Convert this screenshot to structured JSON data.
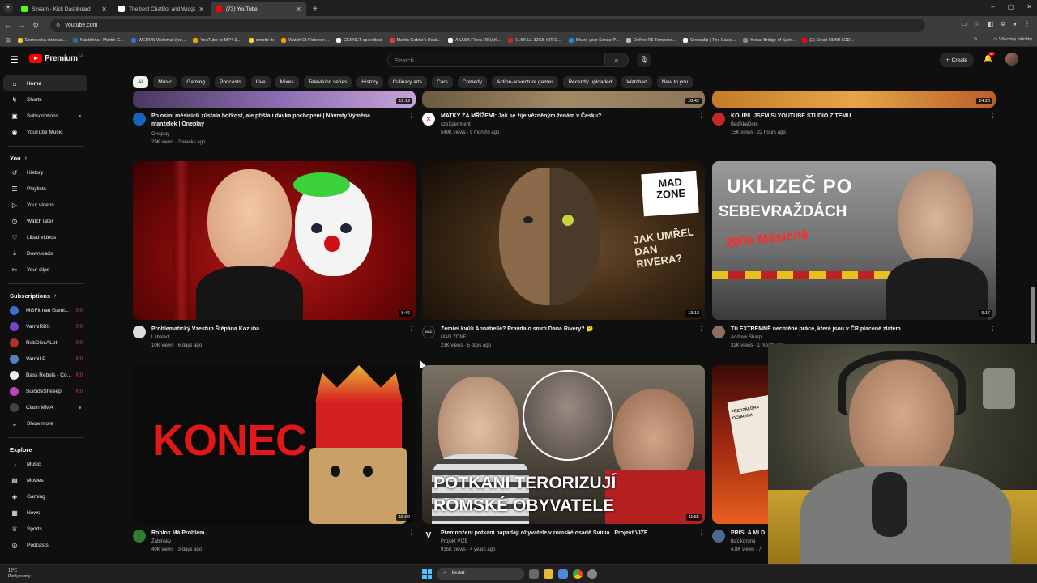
{
  "browser": {
    "tabs": [
      {
        "title": "Stream - Kick Dashboard",
        "color": "#53fc18",
        "active": false
      },
      {
        "title": "The best ChatBot and Widgets",
        "color": "#ffffff",
        "active": false
      },
      {
        "title": "(73) YouTube",
        "color": "#ff0000",
        "active": true
      }
    ],
    "url": "youtube.com",
    "bookmarks": [
      {
        "label": "Domovská stránka...",
        "color": "#f4c430"
      },
      {
        "label": "Nástěnka ‹ Martin G...",
        "color": "#21759b"
      },
      {
        "label": "WEDOS Webmail (we...",
        "color": "#2f6fd6"
      },
      {
        "label": "YouTube to MP4 &...",
        "color": "#e5a800"
      },
      {
        "label": "emotic fb",
        "color": "#f7d43b"
      },
      {
        "label": "Watch Ct Fletcher:...",
        "color": "#ff9800"
      },
      {
        "label": "CESNET speedtest",
        "color": "#ffffff"
      },
      {
        "label": "Martin Gabko's Real...",
        "color": "#e53935"
      },
      {
        "label": "AKASA Flexa V8 (AK...",
        "color": "#ffffff"
      },
      {
        "label": "G.SKILL 32GB KIT D...",
        "color": "#c62828"
      },
      {
        "label": "Share your SensorP...",
        "color": "#1e88e5"
      },
      {
        "label": "Define R6 Tempere...",
        "color": "#bbbbbb"
      },
      {
        "label": "Crossclip | The Easie...",
        "color": "#ffffff"
      },
      {
        "label": "Kena: Bridge of Spiri...",
        "color": "#888888"
      },
      {
        "label": "(2) Sinch HDMI LCD...",
        "color": "#ff0000"
      }
    ],
    "bookmarks_right": "Všechny záložky"
  },
  "header": {
    "logo_text": "Premium",
    "logo_country": "CZ",
    "search_placeholder": "Search",
    "create_label": "Create",
    "notif_count": "9+"
  },
  "sidebar": {
    "main": [
      {
        "label": "Home",
        "icon": "home-icon",
        "glyph": "⌂",
        "active": true
      },
      {
        "label": "Shorts",
        "icon": "shorts-icon",
        "glyph": "↯"
      },
      {
        "label": "Subscriptions",
        "icon": "subscriptions-icon",
        "glyph": "▣",
        "dot": true
      },
      {
        "label": "YouTube Music",
        "icon": "music-icon",
        "glyph": "◉"
      }
    ],
    "you_title": "You",
    "you": [
      {
        "label": "History",
        "icon": "history-icon",
        "glyph": "↺"
      },
      {
        "label": "Playlists",
        "icon": "playlists-icon",
        "glyph": "☰"
      },
      {
        "label": "Your videos",
        "icon": "your-videos-icon",
        "glyph": "▷"
      },
      {
        "label": "Watch later",
        "icon": "watch-later-icon",
        "glyph": "◷"
      },
      {
        "label": "Liked videos",
        "icon": "liked-icon",
        "glyph": "♡"
      },
      {
        "label": "Downloads",
        "icon": "downloads-icon",
        "glyph": "⤓"
      },
      {
        "label": "Your clips",
        "icon": "clips-icon",
        "glyph": "✂"
      }
    ],
    "subs_title": "Subscriptions",
    "subs": [
      {
        "label": "MGFitman Gami...",
        "color": "#3c6fd1",
        "live": "((•))"
      },
      {
        "label": "VarmiRBX",
        "color": "#7b3fd1",
        "live": "((•))"
      },
      {
        "label": "RobDiesALot",
        "color": "#b03030",
        "live": "((•))"
      },
      {
        "label": "VarmiLP",
        "color": "#5080c0",
        "live": "((•))"
      },
      {
        "label": "Bass Rebels - Co...",
        "color": "#eeeeee",
        "live": "((•))"
      },
      {
        "label": "SuicideSheeep",
        "color": "#c040c0",
        "live": "((•))"
      },
      {
        "label": "Clash MMA",
        "color": "#444444",
        "dot": true
      }
    ],
    "show_more": "Show more",
    "explore_title": "Explore",
    "explore": [
      {
        "label": "Music",
        "icon": "music-note-icon",
        "glyph": "♪"
      },
      {
        "label": "Movies",
        "icon": "movies-icon",
        "glyph": "▤"
      },
      {
        "label": "Gaming",
        "icon": "gaming-icon",
        "glyph": "◈"
      },
      {
        "label": "News",
        "icon": "news-icon",
        "glyph": "▦"
      },
      {
        "label": "Sports",
        "icon": "sports-icon",
        "glyph": "♕"
      },
      {
        "label": "Podcasts",
        "icon": "podcasts-icon",
        "glyph": "◎"
      }
    ]
  },
  "chips": [
    "All",
    "Music",
    "Gaming",
    "Podcasts",
    "Live",
    "Mixes",
    "Television series",
    "History",
    "Culinary arts",
    "Cars",
    "Comedy",
    "Action-adventure games",
    "Recently uploaded",
    "Watched",
    "New to you"
  ],
  "videos_top": [
    {
      "title": "Po osmi měsících zůstala hořkost, ale přišla i dávka pochopení | Návraty Výměna manželek | Oneplay",
      "channel": "Oneplay",
      "stats": "29K views · 2 weeks ago",
      "duration": "12:19",
      "avatar": "#1565c0"
    },
    {
      "title": "MATKY ZA MŘÍŽEMI: Jak se žije vězněným ženám v Česku?",
      "channel": "czeXperiment",
      "stats": "549K views · 9 months ago",
      "duration": "18:42",
      "avatar": "#e91e63"
    },
    {
      "title": "KOUPIL JSEM SI YOUTUBE STUDIO Z TEMU",
      "channel": "BedAkaDom",
      "stats": "15K views · 22 hours ago",
      "duration": "14:20",
      "avatar": "#c62828"
    }
  ],
  "videos_mid": [
    {
      "title": "Problematický Vzestup Štěpána Kozuba",
      "channel": "Labeled",
      "stats": "10K views · 6 days ago",
      "duration": "8:46",
      "avatar": "#cccccc"
    },
    {
      "title": "Zemřel kvůli Annabelle? Pravda o smrti Dana Rivery? 🤔",
      "channel": "MAD ZONE",
      "stats": "23K views · 5 days ago",
      "duration": "13:12",
      "avatar": "#111111"
    },
    {
      "title": "Tři EXTRÉMNĚ nechtěné práce, které jsou v ČR placené zlatem",
      "channel": "Andrew Sharp",
      "stats": "32K views · 1 month ago",
      "duration": "9:17",
      "avatar": "#8d6e63"
    }
  ],
  "videos_bottom": [
    {
      "title": "Roblox Má Problém...",
      "channel": "Žabinsky",
      "stats": "40K views · 3 days ago",
      "duration": "15:09",
      "avatar": "#2e7d32"
    },
    {
      "title": "Přemnožení potkani napadají obyvatele v romské osadě Svinia | Projekt VIZE",
      "channel": "Projekt VIZE",
      "stats": "915K views · 4 years ago",
      "duration": "11:55",
      "avatar": "#111111"
    },
    {
      "title": "PŘIŠLA MI D",
      "channel": "tisícikoruna",
      "stats": "4.8K views · 7",
      "duration": "",
      "avatar": "#4a6b8a"
    }
  ],
  "overlays": {
    "mad_zone": "MAD ZONE",
    "jak_umrel": "JAK UMŘEL DAN RIVERA?",
    "uklizec_1": "UKLIZEČ PO",
    "uklizec_2": "SEBEVRAŽDÁCH",
    "salary": "200k Měsíčně",
    "konec": "KONEC",
    "potkani_1": "POTKANI TERORIZUJÍ",
    "potkani_2": "ROMSKÉ OBYVATELE",
    "doc_1": "PŘEDZÁLOHA",
    "doc_2": "OCHRANA"
  },
  "taskbar": {
    "temp": "18°C",
    "weather": "Partly sunny",
    "search": "Hledat"
  }
}
